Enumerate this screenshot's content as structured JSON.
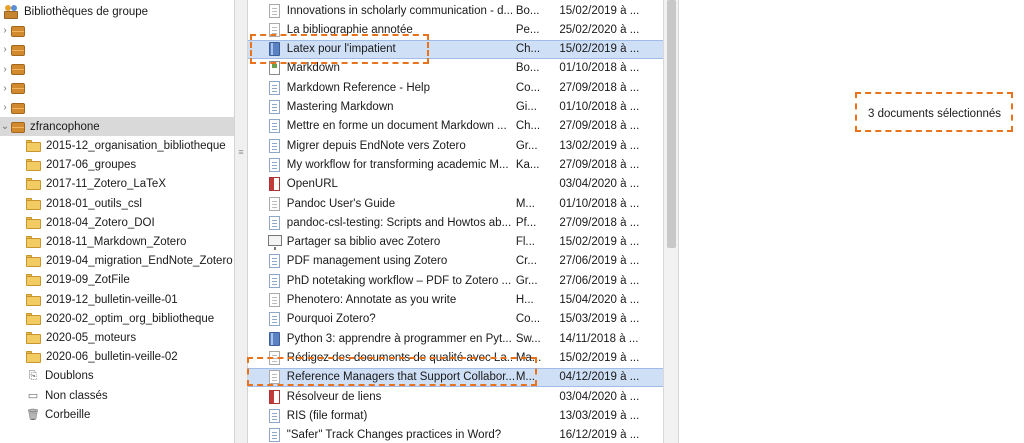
{
  "collections": {
    "root_label": "Bibliothèques de groupe",
    "active_group": "zfrancophone",
    "folders": [
      "2015-12_organisation_bibliotheque",
      "2017-06_groupes",
      "2017-11_Zotero_LaTeX",
      "2018-01_outils_csl",
      "2018-04_Zotero_DOI",
      "2018-11_Markdown_Zotero",
      "2019-04_migration_EndNote_Zotero",
      "2019-09_ZotFile",
      "2019-12_bulletin-veille-01",
      "2020-02_optim_org_bibliotheque",
      "2020-05_moteurs",
      "2020-06_bulletin-veille-02"
    ],
    "duplicates": "Doublons",
    "unfiled": "Non classés",
    "trash": "Corbeille"
  },
  "items": [
    {
      "title": "Innovations in scholarly communication - d...",
      "creator": "Bo...",
      "date": "15/02/2019 à ...",
      "icon": "web-page-icon"
    },
    {
      "title": "La bibliographie annotée",
      "creator": "Pe...",
      "date": "25/02/2020 à ...",
      "icon": "web-page-icon"
    },
    {
      "title": "Latex pour l'impatient",
      "creator": "Ch...",
      "date": "15/02/2019 à ...",
      "icon": "book-icon",
      "selected": true
    },
    {
      "title": "Markdown",
      "creator": "Bo...",
      "date": "01/10/2018 à ...",
      "icon": "report-icon"
    },
    {
      "title": "Markdown Reference - Help",
      "creator": "Co...",
      "date": "27/09/2018 à ...",
      "icon": "document-icon"
    },
    {
      "title": "Mastering Markdown",
      "creator": "Gi...",
      "date": "01/10/2018 à ...",
      "icon": "document-icon"
    },
    {
      "title": "Mettre en forme un document Markdown ...",
      "creator": "Ch...",
      "date": "27/09/2018 à ...",
      "icon": "document-icon"
    },
    {
      "title": "Migrer depuis EndNote vers Zotero",
      "creator": "Gr...",
      "date": "13/02/2019 à ...",
      "icon": "document-icon"
    },
    {
      "title": "My workflow for transforming academic M...",
      "creator": "Ka...",
      "date": "27/09/2018 à ...",
      "icon": "document-icon"
    },
    {
      "title": "OpenURL",
      "creator": "",
      "date": "03/04/2020 à ...",
      "icon": "pdf-icon"
    },
    {
      "title": "Pandoc User's Guide",
      "creator": "M...",
      "date": "01/10/2018 à ...",
      "icon": "web-page-icon"
    },
    {
      "title": "pandoc-csl-testing: Scripts and Howtos ab...",
      "creator": "Pf...",
      "date": "27/09/2018 à ...",
      "icon": "document-icon"
    },
    {
      "title": "Partager sa biblio avec Zotero",
      "creator": "Fl...",
      "date": "15/02/2019 à ...",
      "icon": "presentation-icon"
    },
    {
      "title": "PDF management using Zotero",
      "creator": "Cr...",
      "date": "27/06/2019 à ...",
      "icon": "document-icon"
    },
    {
      "title": "PhD notetaking workflow – PDF to Zotero ...",
      "creator": "Gr...",
      "date": "27/06/2019 à ...",
      "icon": "document-icon"
    },
    {
      "title": "Phenotero: Annotate as you write",
      "creator": "H...",
      "date": "15/04/2020 à ...",
      "icon": "web-page-icon"
    },
    {
      "title": "Pourquoi Zotero?",
      "creator": "Co...",
      "date": "15/03/2019 à ...",
      "icon": "document-icon"
    },
    {
      "title": "Python 3: apprendre à programmer en Pyt...",
      "creator": "Sw...",
      "date": "14/11/2018 à ...",
      "icon": "book-icon"
    },
    {
      "title": "Rédigez des documents de qualité avec La...",
      "creator": "Ma...",
      "date": "15/02/2019 à ...",
      "icon": "web-page-icon"
    },
    {
      "title": "Reference Managers that Support Collabor...",
      "creator": "M...",
      "date": "04/12/2019 à ...",
      "icon": "web-page-icon",
      "selected": true
    },
    {
      "title": "Résolveur de liens",
      "creator": "",
      "date": "03/04/2020 à ...",
      "icon": "pdf-icon"
    },
    {
      "title": "RIS (file format)",
      "creator": "",
      "date": "13/03/2019 à ...",
      "icon": "document-icon"
    },
    {
      "title": "\"Safer\" Track Changes practices in Word?",
      "creator": "",
      "date": "16/12/2019 à ...",
      "icon": "document-icon"
    }
  ],
  "selection_message": "3 documents sélectionnés",
  "colors": {
    "selection_blue": "#cfe0f6",
    "annotation_orange": "#e8731c",
    "folder_yellow": "#f2cc62",
    "library_orange": "#d18a2e"
  }
}
